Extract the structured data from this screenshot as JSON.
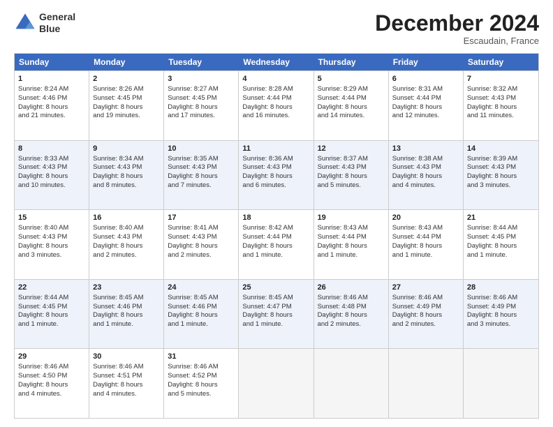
{
  "header": {
    "logo_line1": "General",
    "logo_line2": "Blue",
    "month_title": "December 2024",
    "location": "Escaudain, France"
  },
  "days_of_week": [
    "Sunday",
    "Monday",
    "Tuesday",
    "Wednesday",
    "Thursday",
    "Friday",
    "Saturday"
  ],
  "weeks": [
    [
      {
        "day": 1,
        "lines": [
          "Sunrise: 8:24 AM",
          "Sunset: 4:46 PM",
          "Daylight: 8 hours",
          "and 21 minutes."
        ]
      },
      {
        "day": 2,
        "lines": [
          "Sunrise: 8:26 AM",
          "Sunset: 4:45 PM",
          "Daylight: 8 hours",
          "and 19 minutes."
        ]
      },
      {
        "day": 3,
        "lines": [
          "Sunrise: 8:27 AM",
          "Sunset: 4:45 PM",
          "Daylight: 8 hours",
          "and 17 minutes."
        ]
      },
      {
        "day": 4,
        "lines": [
          "Sunrise: 8:28 AM",
          "Sunset: 4:44 PM",
          "Daylight: 8 hours",
          "and 16 minutes."
        ]
      },
      {
        "day": 5,
        "lines": [
          "Sunrise: 8:29 AM",
          "Sunset: 4:44 PM",
          "Daylight: 8 hours",
          "and 14 minutes."
        ]
      },
      {
        "day": 6,
        "lines": [
          "Sunrise: 8:31 AM",
          "Sunset: 4:44 PM",
          "Daylight: 8 hours",
          "and 12 minutes."
        ]
      },
      {
        "day": 7,
        "lines": [
          "Sunrise: 8:32 AM",
          "Sunset: 4:43 PM",
          "Daylight: 8 hours",
          "and 11 minutes."
        ]
      }
    ],
    [
      {
        "day": 8,
        "lines": [
          "Sunrise: 8:33 AM",
          "Sunset: 4:43 PM",
          "Daylight: 8 hours",
          "and 10 minutes."
        ]
      },
      {
        "day": 9,
        "lines": [
          "Sunrise: 8:34 AM",
          "Sunset: 4:43 PM",
          "Daylight: 8 hours",
          "and 8 minutes."
        ]
      },
      {
        "day": 10,
        "lines": [
          "Sunrise: 8:35 AM",
          "Sunset: 4:43 PM",
          "Daylight: 8 hours",
          "and 7 minutes."
        ]
      },
      {
        "day": 11,
        "lines": [
          "Sunrise: 8:36 AM",
          "Sunset: 4:43 PM",
          "Daylight: 8 hours",
          "and 6 minutes."
        ]
      },
      {
        "day": 12,
        "lines": [
          "Sunrise: 8:37 AM",
          "Sunset: 4:43 PM",
          "Daylight: 8 hours",
          "and 5 minutes."
        ]
      },
      {
        "day": 13,
        "lines": [
          "Sunrise: 8:38 AM",
          "Sunset: 4:43 PM",
          "Daylight: 8 hours",
          "and 4 minutes."
        ]
      },
      {
        "day": 14,
        "lines": [
          "Sunrise: 8:39 AM",
          "Sunset: 4:43 PM",
          "Daylight: 8 hours",
          "and 3 minutes."
        ]
      }
    ],
    [
      {
        "day": 15,
        "lines": [
          "Sunrise: 8:40 AM",
          "Sunset: 4:43 PM",
          "Daylight: 8 hours",
          "and 3 minutes."
        ]
      },
      {
        "day": 16,
        "lines": [
          "Sunrise: 8:40 AM",
          "Sunset: 4:43 PM",
          "Daylight: 8 hours",
          "and 2 minutes."
        ]
      },
      {
        "day": 17,
        "lines": [
          "Sunrise: 8:41 AM",
          "Sunset: 4:43 PM",
          "Daylight: 8 hours",
          "and 2 minutes."
        ]
      },
      {
        "day": 18,
        "lines": [
          "Sunrise: 8:42 AM",
          "Sunset: 4:44 PM",
          "Daylight: 8 hours",
          "and 1 minute."
        ]
      },
      {
        "day": 19,
        "lines": [
          "Sunrise: 8:43 AM",
          "Sunset: 4:44 PM",
          "Daylight: 8 hours",
          "and 1 minute."
        ]
      },
      {
        "day": 20,
        "lines": [
          "Sunrise: 8:43 AM",
          "Sunset: 4:44 PM",
          "Daylight: 8 hours",
          "and 1 minute."
        ]
      },
      {
        "day": 21,
        "lines": [
          "Sunrise: 8:44 AM",
          "Sunset: 4:45 PM",
          "Daylight: 8 hours",
          "and 1 minute."
        ]
      }
    ],
    [
      {
        "day": 22,
        "lines": [
          "Sunrise: 8:44 AM",
          "Sunset: 4:45 PM",
          "Daylight: 8 hours",
          "and 1 minute."
        ]
      },
      {
        "day": 23,
        "lines": [
          "Sunrise: 8:45 AM",
          "Sunset: 4:46 PM",
          "Daylight: 8 hours",
          "and 1 minute."
        ]
      },
      {
        "day": 24,
        "lines": [
          "Sunrise: 8:45 AM",
          "Sunset: 4:46 PM",
          "Daylight: 8 hours",
          "and 1 minute."
        ]
      },
      {
        "day": 25,
        "lines": [
          "Sunrise: 8:45 AM",
          "Sunset: 4:47 PM",
          "Daylight: 8 hours",
          "and 1 minute."
        ]
      },
      {
        "day": 26,
        "lines": [
          "Sunrise: 8:46 AM",
          "Sunset: 4:48 PM",
          "Daylight: 8 hours",
          "and 2 minutes."
        ]
      },
      {
        "day": 27,
        "lines": [
          "Sunrise: 8:46 AM",
          "Sunset: 4:49 PM",
          "Daylight: 8 hours",
          "and 2 minutes."
        ]
      },
      {
        "day": 28,
        "lines": [
          "Sunrise: 8:46 AM",
          "Sunset: 4:49 PM",
          "Daylight: 8 hours",
          "and 3 minutes."
        ]
      }
    ],
    [
      {
        "day": 29,
        "lines": [
          "Sunrise: 8:46 AM",
          "Sunset: 4:50 PM",
          "Daylight: 8 hours",
          "and 4 minutes."
        ]
      },
      {
        "day": 30,
        "lines": [
          "Sunrise: 8:46 AM",
          "Sunset: 4:51 PM",
          "Daylight: 8 hours",
          "and 4 minutes."
        ]
      },
      {
        "day": 31,
        "lines": [
          "Sunrise: 8:46 AM",
          "Sunset: 4:52 PM",
          "Daylight: 8 hours",
          "and 5 minutes."
        ]
      },
      null,
      null,
      null,
      null
    ]
  ]
}
